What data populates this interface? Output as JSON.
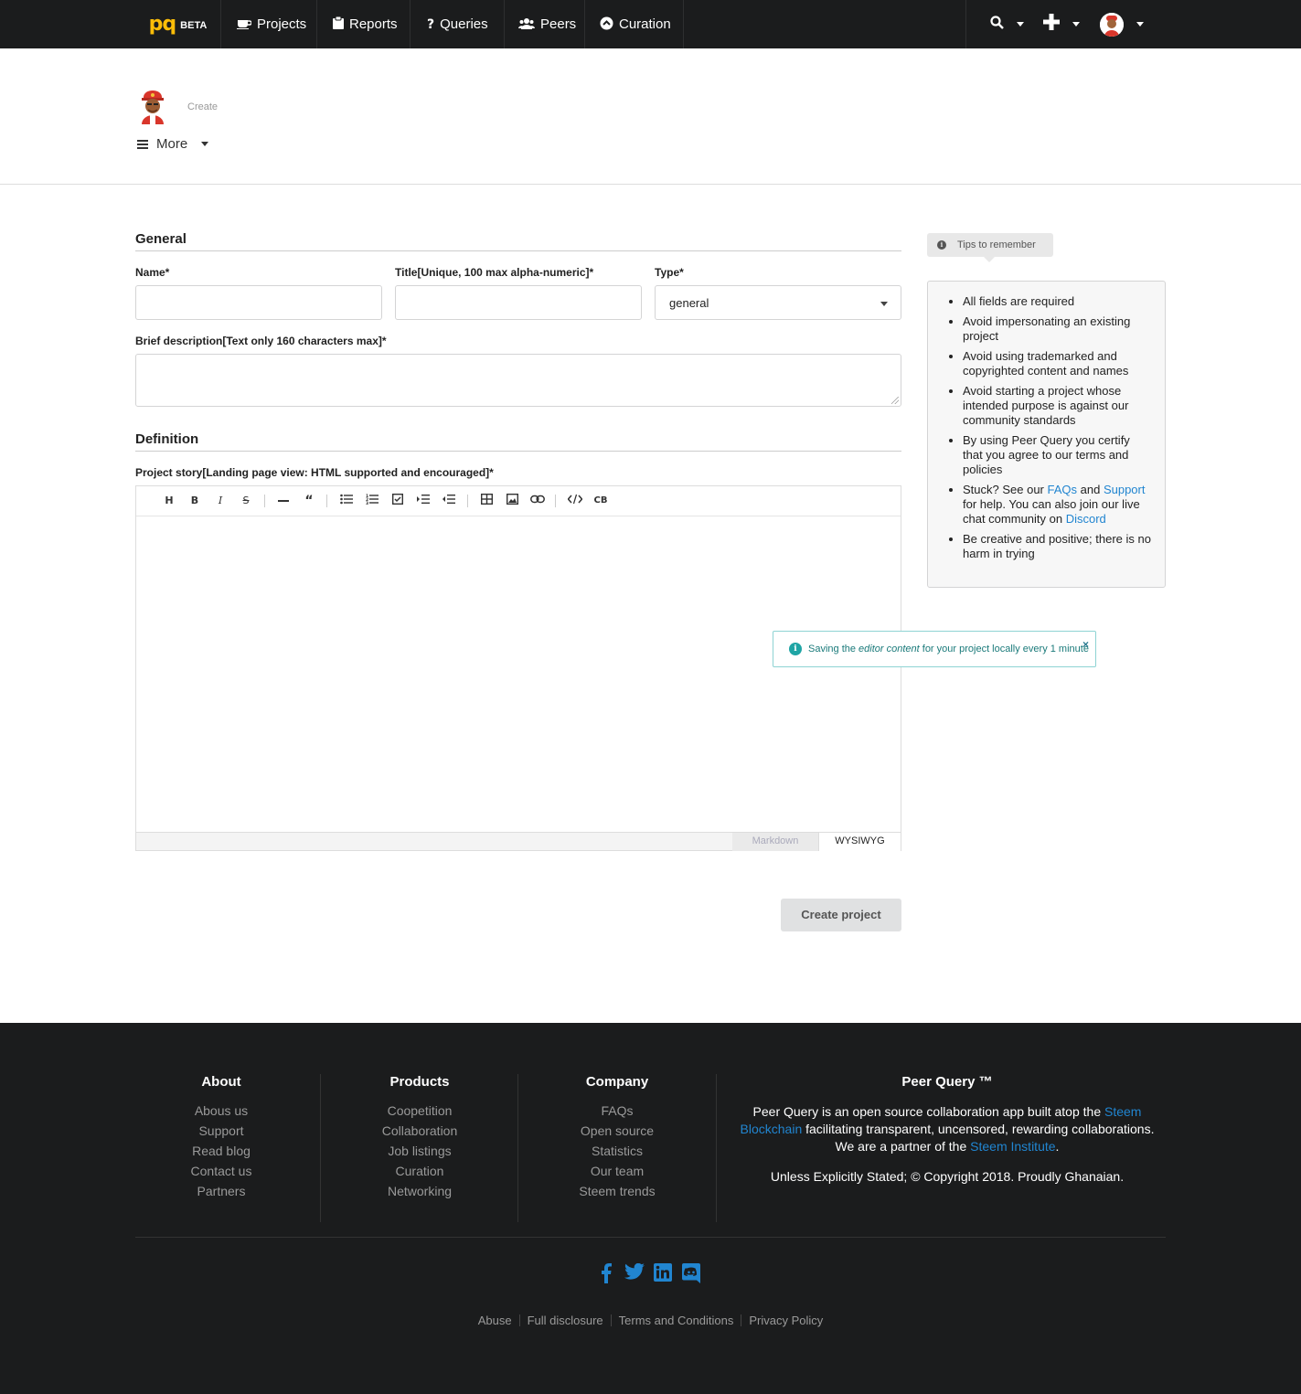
{
  "nav": {
    "brand_logo": "pq",
    "brand_badge": "BETA",
    "items": [
      {
        "label": "Projects",
        "icon": "coffee-cup-icon"
      },
      {
        "label": "Reports",
        "icon": "clipboard-icon"
      },
      {
        "label": "Queries",
        "icon": "question-icon"
      },
      {
        "label": "Peers",
        "icon": "users-icon"
      },
      {
        "label": "Curation",
        "icon": "chevron-circle-up-icon"
      }
    ]
  },
  "profile": {
    "crumb": "Create",
    "more_label": "More"
  },
  "form": {
    "general_heading": "General",
    "name_label": "Name*",
    "title_label": "Title[Unique, 100 max alpha-numeric]*",
    "type_label": "Type*",
    "type_value": "general",
    "brief_label": "Brief description[Text only 160 characters max]*",
    "definition_heading": "Definition",
    "story_label": "Project story[Landing page view: HTML supported and encouraged]*",
    "editor_modes": [
      "Markdown",
      "WYSIWYG"
    ],
    "toolbar": [
      "H",
      "B",
      "I",
      "S",
      "hr",
      "quote",
      "ul",
      "ol",
      "task",
      "indent",
      "outdent",
      "table",
      "image",
      "link",
      "code",
      "CB"
    ],
    "submit_label": "Create project"
  },
  "toast": {
    "prefix": "Saving the ",
    "emph": "editor content",
    "suffix": " for your project locally every 1 minute",
    "close": "×"
  },
  "tips": {
    "label": "Tips to remember",
    "items": [
      "All fields are required",
      "Avoid impersonating an existing project",
      "Avoid using trademarked and copyrighted content and names",
      "Avoid starting a project whose intended purpose is against our community standards",
      "By using Peer Query you certify that you agree to our terms and policies"
    ],
    "stuck": {
      "t1": "Stuck? See our ",
      "l1": "FAQs",
      "t2": " and ",
      "l2": "Support",
      "t3": " for help. You can also join our live chat community on ",
      "l3": "Discord"
    },
    "last": "Be creative and positive; there is no harm in trying"
  },
  "footer": {
    "about": {
      "title": "About",
      "links": [
        "Abous us",
        "Support",
        "Read blog",
        "Contact us",
        "Partners"
      ]
    },
    "products": {
      "title": "Products",
      "links": [
        "Coopetition",
        "Collaboration",
        "Job listings",
        "Curation",
        "Networking"
      ]
    },
    "company": {
      "title": "Company",
      "links": [
        "FAQs",
        "Open source",
        "Statistics",
        "Our team",
        "Steem trends"
      ]
    },
    "pq": {
      "title": "Peer Query ™",
      "t1": "Peer Query is an open source collaboration app built atop the ",
      "l1": "Steem Blockchain",
      "t2": " facilitating transparent, uncensored, rewarding collaborations. We are a partner of the ",
      "l2": "Steem Institute",
      "t3": ".",
      "copyright": "Unless Explicitly Stated; © Copyright 2018. Proudly Ghanaian."
    },
    "social": [
      {
        "icon": "facebook-icon",
        "glyph": "f"
      },
      {
        "icon": "twitter-icon",
        "glyph": "t"
      },
      {
        "icon": "linkedin-icon",
        "glyph": "in"
      },
      {
        "icon": "discord-icon",
        "glyph": "d"
      }
    ],
    "legal": [
      "Abuse",
      "Full disclosure",
      "Terms and Conditions",
      "Privacy Policy"
    ]
  },
  "colors": {
    "nav_bg": "#1b1c1d",
    "link_blue": "#2185d0",
    "brand_yellow": "#fbbd08",
    "toast_teal": "#1fa5a5"
  }
}
